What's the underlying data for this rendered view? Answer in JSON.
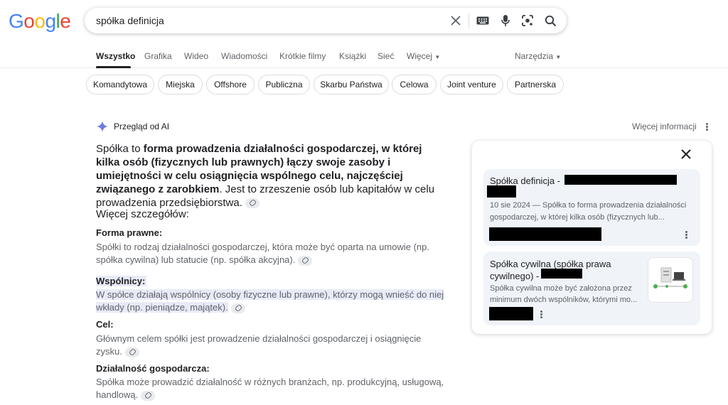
{
  "logo": {
    "letters": [
      "G",
      "o",
      "o",
      "g",
      "l",
      "e"
    ],
    "colors": [
      "#4285F4",
      "#EA4335",
      "#FBBC05",
      "#4285F4",
      "#34A853",
      "#EA4335"
    ]
  },
  "search": {
    "value": "spółka definicja",
    "icons": [
      "close-icon",
      "keyboard-icon",
      "mic-icon",
      "lens-icon",
      "search-icon"
    ]
  },
  "tabs": {
    "all": "Wszystko",
    "images": "Grafika",
    "videos": "Wideo",
    "news": "Wiadomości",
    "shorts": "Krótkie filmy",
    "books": "Książki",
    "web": "Sieć",
    "more": "Więcej",
    "tools": "Narzędzia"
  },
  "chips": [
    "Komandytowa",
    "Miejska",
    "Offshore",
    "Publiczna",
    "Skarbu Państwa",
    "Celowa",
    "Joint venture",
    "Partnerska"
  ],
  "ai": {
    "header": "Przegląd od AI",
    "more_info": "Więcej informacji",
    "summary_start": "Spółka to ",
    "summary_bold": "forma prowadzenia działalności gospodarczej, w której kilka osób (fizycznych lub prawnych) łączy swoje zasoby i umiejętności w celu osiągnięcia wspólnego celu, najczęściej związanego z zarobkiem",
    "summary_end": ". Jest to zrzeszenie osób lub kapitałów w celu prowadzenia przedsiębiorstwa.",
    "details_title": "Więcej szczegółów:",
    "items": [
      {
        "title": "Forma prawne:",
        "text": "Spółki to rodzaj działalności gospodarczej, która może być oparta na umowie (np. spółka cywilna) lub statucie (np. spółka akcyjna)."
      },
      {
        "title": "Wspólnicy:",
        "text": "W spółce działają wspólnicy (osoby fizyczne lub prawne), którzy mogą wnieść do niej wkłady (np. pieniądze, majątek)."
      },
      {
        "title": "Cel:",
        "text": "Głównym celem spółki jest prowadzenie działalności gospodarczej i osiągnięcie zysku."
      },
      {
        "title": "Działalność gospodarcza:",
        "text": "Spółka może prowadzić działalność w różnych branżach, np. produkcyjną, usługową, handlową."
      }
    ]
  },
  "sources": {
    "cards": [
      {
        "title": "Spółka definicja -",
        "text1": "10 sie 2024 — Spółka to forma prowadzenia działalności",
        "text2": "gospodarczej, w której kilka osób (fizycznych lub..."
      },
      {
        "title1": "Spółka cywilna (spółka prawa",
        "title2": "cywilnego) -",
        "text1": "Spółka cywilna może być założona przez",
        "text2": "minimum dwóch wspólników, którymi mo..."
      }
    ]
  }
}
